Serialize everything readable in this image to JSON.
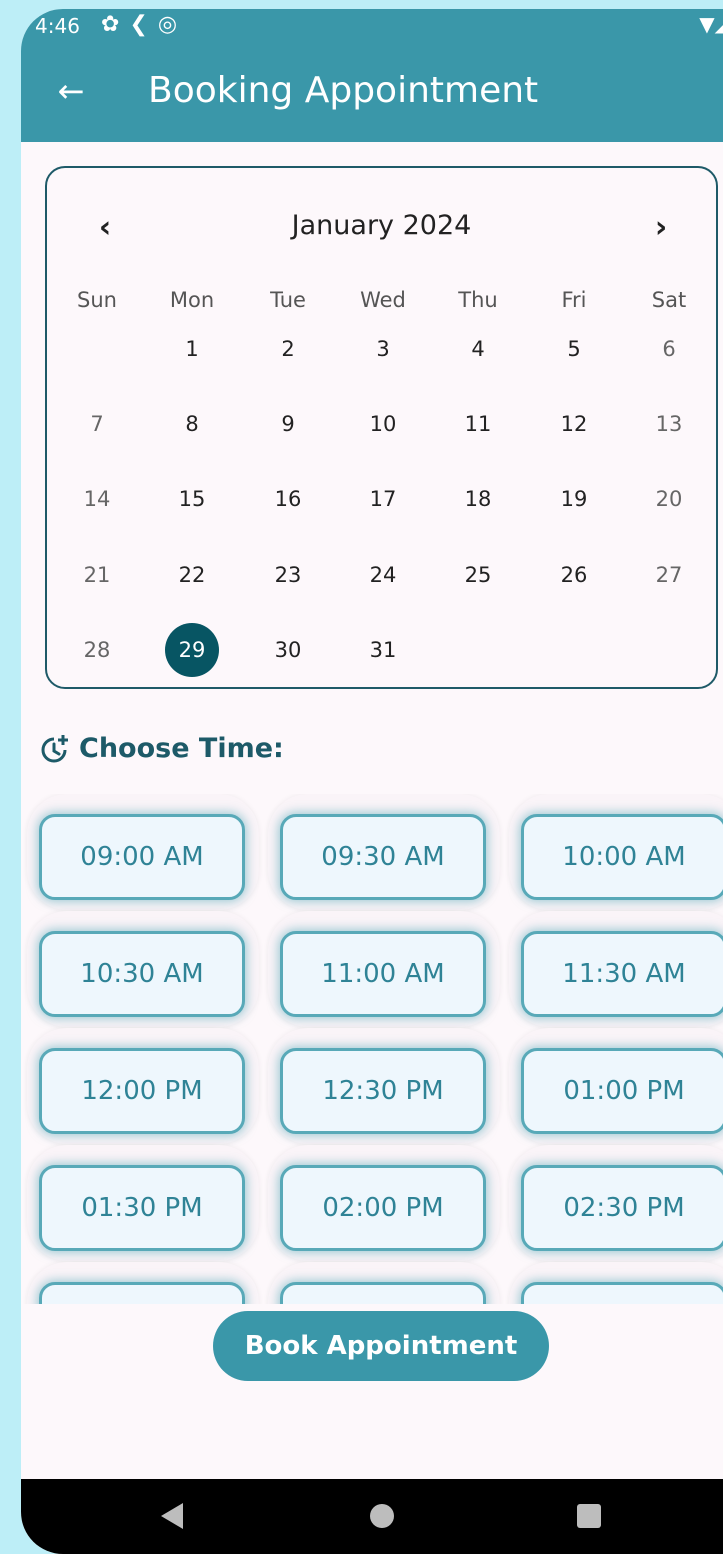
{
  "status_bar": {
    "time": "4:46",
    "left_icons": [
      "gear-icon",
      "flutter-icon",
      "data-saver-icon"
    ],
    "right_icons": "▼◢▮"
  },
  "app_bar": {
    "back_icon": "arrow-left-icon",
    "title": "Booking Appointment",
    "color": "#3a97a9"
  },
  "calendar": {
    "month_label": "January 2024",
    "prev_icon": "chevron-left-icon",
    "next_icon": "chevron-right-icon",
    "weekdays": [
      "Sun",
      "Mon",
      "Tue",
      "Wed",
      "Thu",
      "Fri",
      "Sat"
    ],
    "first_weekday_index": 1,
    "days_in_month": 31,
    "days": [
      "1",
      "2",
      "3",
      "4",
      "5",
      "6",
      "7",
      "8",
      "9",
      "10",
      "11",
      "12",
      "13",
      "14",
      "15",
      "16",
      "17",
      "18",
      "19",
      "20",
      "21",
      "22",
      "23",
      "24",
      "25",
      "26",
      "27",
      "28",
      "29",
      "30",
      "31"
    ],
    "selected_day": "29",
    "selected_color": "#075563"
  },
  "time_section": {
    "icon": "clock-plus-icon",
    "title": "Choose Time:"
  },
  "time_slots": [
    "09:00 AM",
    "09:30 AM",
    "10:00 AM",
    "10:30 AM",
    "11:00 AM",
    "11:30 AM",
    "12:00 PM",
    "12:30 PM",
    "01:00 PM",
    "01:30 PM",
    "02:00 PM",
    "02:30 PM",
    "",
    "",
    ""
  ],
  "book_button": {
    "label": "Book Appointment"
  },
  "nav_bar": {
    "back_icon": "nav-back-icon",
    "home_icon": "nav-home-icon",
    "recents_icon": "nav-recents-icon"
  }
}
